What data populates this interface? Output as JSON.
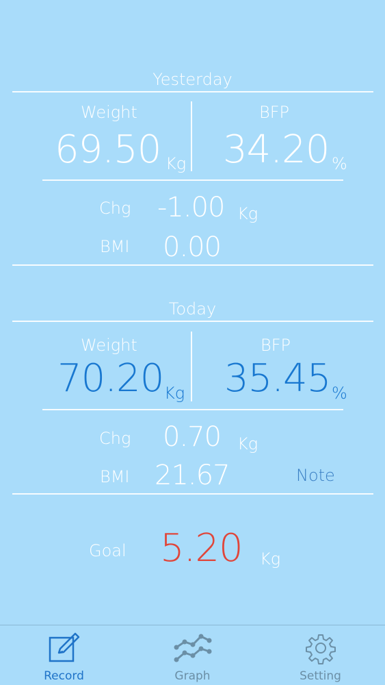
{
  "yesterday": {
    "title": "Yesterday",
    "weight_label": "Weight",
    "weight_value": "69.50",
    "weight_unit": "Kg",
    "bfp_label": "BFP",
    "bfp_value": "34.20",
    "bfp_unit": "%",
    "chg_label": "Chg",
    "chg_value": "-1.00",
    "chg_unit": "Kg",
    "bmi_label": "BMI",
    "bmi_value": "0.00"
  },
  "today": {
    "title": "Today",
    "weight_label": "Weight",
    "weight_value": "70.20",
    "weight_unit": "Kg",
    "bfp_label": "BFP",
    "bfp_value": "35.45",
    "bfp_unit": "%",
    "chg_label": "Chg",
    "chg_value": "0.70",
    "chg_unit": "Kg",
    "bmi_label": "BMI",
    "bmi_value": "21.67",
    "note_label": "Note"
  },
  "goal": {
    "label": "Goal",
    "value": "5.20",
    "unit": "Kg"
  },
  "tabbar": {
    "tabs": [
      {
        "label": "Record",
        "icon": "pencil-square-icon",
        "active": true
      },
      {
        "label": "Graph",
        "icon": "graph-icon",
        "active": false
      },
      {
        "label": "Setting",
        "icon": "gear-icon",
        "active": false
      }
    ]
  },
  "colors": {
    "background": "#a9dcfa",
    "today_value": "#1877d0",
    "goal_value": "#e0463a",
    "active_tab": "#1f73c8",
    "inactive_tab": "#6b8fa6"
  }
}
